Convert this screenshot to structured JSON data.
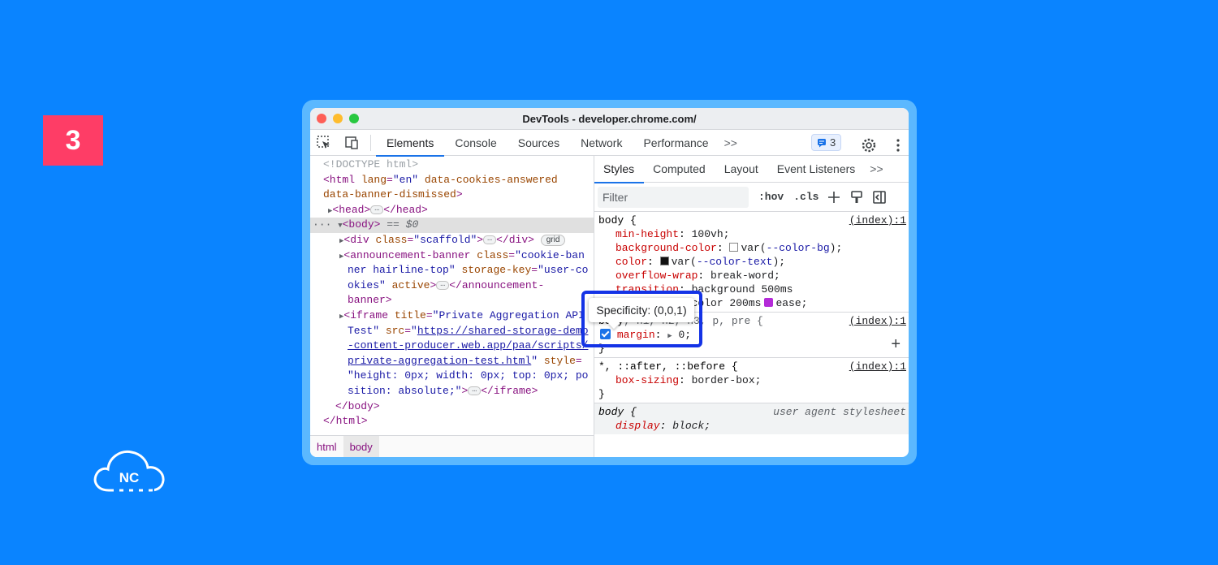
{
  "step_badge": "3",
  "logo_text": "NC",
  "window": {
    "title": "DevTools - developer.chrome.com/"
  },
  "toolbar": {
    "tabs": [
      "Elements",
      "Console",
      "Sources",
      "Network",
      "Performance"
    ],
    "more": ">>",
    "issues_count": "3"
  },
  "dom": {
    "l1": "<!DOCTYPE html>",
    "html_open": "<html",
    "html_attr1": "lang",
    "html_val1": "\"en\"",
    "html_attr2": "data-cookies-answered",
    "html_attr3": "data-banner-dismissed",
    "head": "<head>",
    "head_close": "</head>",
    "body_open": "<body>",
    "body_eq": "== $0",
    "div_open": "<div",
    "div_attr": "class",
    "div_val": "\"scaffold\"",
    "div_close": "</div>",
    "grid_pill": "grid",
    "ab_open": "<announcement-banner",
    "ab_attr1": "class",
    "ab_val1a": "\"cookie-ban",
    "ab_val1b": "ner hairline-top\"",
    "ab_attr2": "storage-key",
    "ab_val2a": "\"user-co",
    "ab_val2b": "okies\"",
    "ab_attr3": "active",
    "ab_close_a": "</announcement-",
    "ab_close_b": "banner>",
    "if_open": "<iframe",
    "if_attr1": "title",
    "if_val1a": "\"Private Aggregation API",
    "if_val1b": "Test\"",
    "if_attr2": "src",
    "if_link1": "https://shared-storage-demo",
    "if_link2": "-content-producer.web.app/paa/scripts/",
    "if_link3": "private-aggregation-test.html",
    "if_attr3": "style",
    "if_style1": "\"height: 0px; width: 0px; top: 0px; po",
    "if_style2": "sition: absolute;\"",
    "if_close": "</iframe>",
    "body_close": "</body>",
    "html_close": "</html>"
  },
  "breadcrumbs": [
    "html",
    "body"
  ],
  "styles": {
    "subtabs": [
      "Styles",
      "Computed",
      "Layout",
      "Event Listeners"
    ],
    "more": ">>",
    "filter_placeholder": "Filter",
    "hov": ":hov",
    "cls": ".cls",
    "rule1": {
      "selector": "body {",
      "source": "(index):1",
      "props": [
        [
          "min-height",
          "100vh;"
        ],
        [
          "background-color",
          "var(",
          "--color-bg",
          ");"
        ],
        [
          "color",
          "var(",
          "--color-text",
          ");"
        ],
        [
          "overflow-wrap",
          "break-word;"
        ],
        [
          "transition",
          "background 500ms"
        ],
        [
          "",
          "ease-in-out,color 200ms",
          "ease;"
        ]
      ]
    },
    "rule2": {
      "selector_main": "body",
      "selector_rest": ", h1, h2, h3, p, pre {",
      "source": "(index):1",
      "prop": "margin",
      "val": "0;"
    },
    "rule3": {
      "selector": "*, ::after, ::before {",
      "source": "(index):1",
      "prop": "box-sizing",
      "val": "border-box;"
    },
    "rule4": {
      "selector": "body {",
      "source": "user agent stylesheet",
      "prop": "display",
      "val": "block;"
    },
    "close_brace": "}"
  },
  "tooltip": "Specificity: (0,0,1)",
  "colors": {
    "background": "#0a84ff",
    "badge": "#fe3d66",
    "highlight": "#1433e6",
    "accent": "#1a73e8"
  }
}
